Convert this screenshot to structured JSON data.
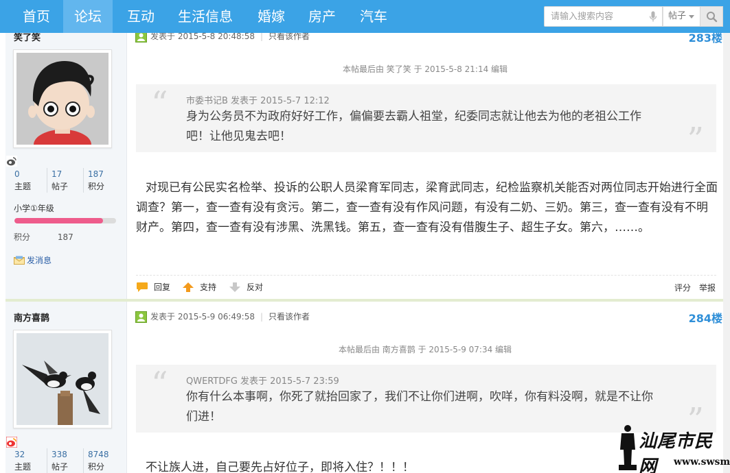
{
  "nav": {
    "items": [
      {
        "label": "首页",
        "active": false
      },
      {
        "label": "论坛",
        "active": true
      },
      {
        "label": "互动",
        "active": false
      },
      {
        "label": "生活信息",
        "active": false
      },
      {
        "label": "婚嫁",
        "active": false
      },
      {
        "label": "房产",
        "active": false
      },
      {
        "label": "汽车",
        "active": false
      }
    ],
    "search_placeholder": "请输入搜索内容",
    "search_type": "帖子"
  },
  "post1": {
    "user": {
      "name": "笑了笑",
      "topics": "0",
      "posts": "17",
      "points": "187",
      "topics_label": "主题",
      "posts_label": "帖子",
      "points_label": "积分",
      "level": "小学①年级",
      "level_progress": 0.87,
      "score_label": "积分",
      "score": "187",
      "message": "发消息"
    },
    "meta_posted": "发表于 2015-5-8 20:48:58",
    "only_author": "只看该作者",
    "floor": "283楼",
    "edit_note": "本帖最后由 笑了笑 于 2015-5-8 21:14 编辑",
    "quote_author": "市委书记B 发表于 2015-5-7 12:12",
    "quote_text": "身为公务员不为政府好好工作，偏偏要去霸人祖堂，纪委同志就让他去为他的老祖公工作吧！让他见鬼去吧！",
    "body": "对现已有公民实名检举、投诉的公职人员梁育军同志，梁育武同志，纪检监察机关能否对两位同志开始进行全面调查？第一，查一查有没有贪污。第二，查一查有没有作风问题，有没有二奶、三奶。第三，查一查有没有不明财产。第四，查一查有没有涉黑、洗黑钱。第五，查一查有没有借腹生子、超生子女。第六，……。",
    "actions": {
      "reply": "回复",
      "support": "支持",
      "oppose": "反对",
      "rate": "评分",
      "report": "举报"
    }
  },
  "post2": {
    "user": {
      "name": "南方喜鹊",
      "topics": "32",
      "posts": "338",
      "points": "8748",
      "topics_label": "主题",
      "posts_label": "帖子",
      "points_label": "积分"
    },
    "meta_posted": "发表于 2015-5-9 06:49:58",
    "only_author": "只看该作者",
    "floor": "284楼",
    "edit_note": "本帖最后由 南方喜鹊 于 2015-5-9 07:34 编辑",
    "quote_author": "QWERTDFG 发表于 2015-5-7 23:59",
    "quote_text": "你有什么本事啊，你死了就抬回家了，我们不让你们进啊，吹咩，你有料没啊，就是不让你们进！",
    "body": "不让族人进，自己要先占好位子，即将入住？！！！"
  },
  "watermark": {
    "name": "汕尾市民网",
    "url": "www.swsm.net"
  },
  "colors": {
    "nav": "#3ba3e6",
    "nav_active": "#62b6ee",
    "floor": "#2f8fd8",
    "level_fill": "#ee5c8c"
  }
}
